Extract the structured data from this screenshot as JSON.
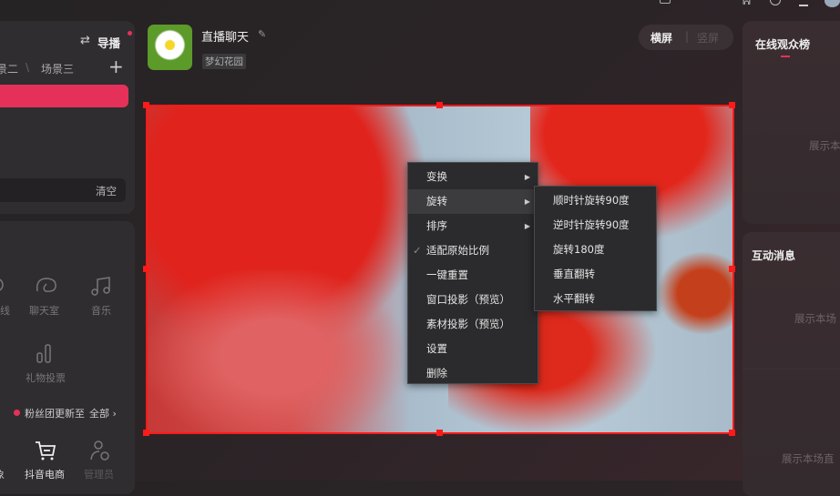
{
  "left_panel": {
    "director_label": "导播",
    "scene_tabs": [
      "景二",
      "场景三"
    ],
    "clear_label": "清空"
  },
  "tools": {
    "row1": [
      "线",
      "聊天室",
      "音乐"
    ],
    "row2": [
      "礼物投票"
    ],
    "fan_update": "粉丝团更新至",
    "fan_all": "全部",
    "bottom": [
      "象",
      "抖音电商",
      "管理员"
    ]
  },
  "header": {
    "title": "直播聊天",
    "tag": "梦幻花园",
    "orientation": [
      "横屏",
      "竖屏"
    ]
  },
  "context_menu": {
    "items": [
      {
        "label": "变换",
        "sub": true
      },
      {
        "label": "旋转",
        "sub": true,
        "active": true
      },
      {
        "label": "排序",
        "sub": true
      },
      {
        "label": "适配原始比例",
        "checked": true
      },
      {
        "label": "一键重置"
      },
      {
        "label": "窗口投影（预览）"
      },
      {
        "label": "素材投影（预览）"
      },
      {
        "label": "设置"
      },
      {
        "label": "删除"
      }
    ]
  },
  "rotate_submenu": [
    "顺时针旋转90度",
    "逆时针旋转90度",
    "旋转180度",
    "垂直翻转",
    "水平翻转"
  ],
  "right_panel": {
    "audience_title": "在线观众榜",
    "audience_empty": "展示本",
    "messages_title": "互动消息",
    "messages_empty": "展示本场",
    "bottom_empty": "展示本场直"
  },
  "colors": {
    "accent": "#e5315a",
    "selection": "#ff1a1a"
  }
}
